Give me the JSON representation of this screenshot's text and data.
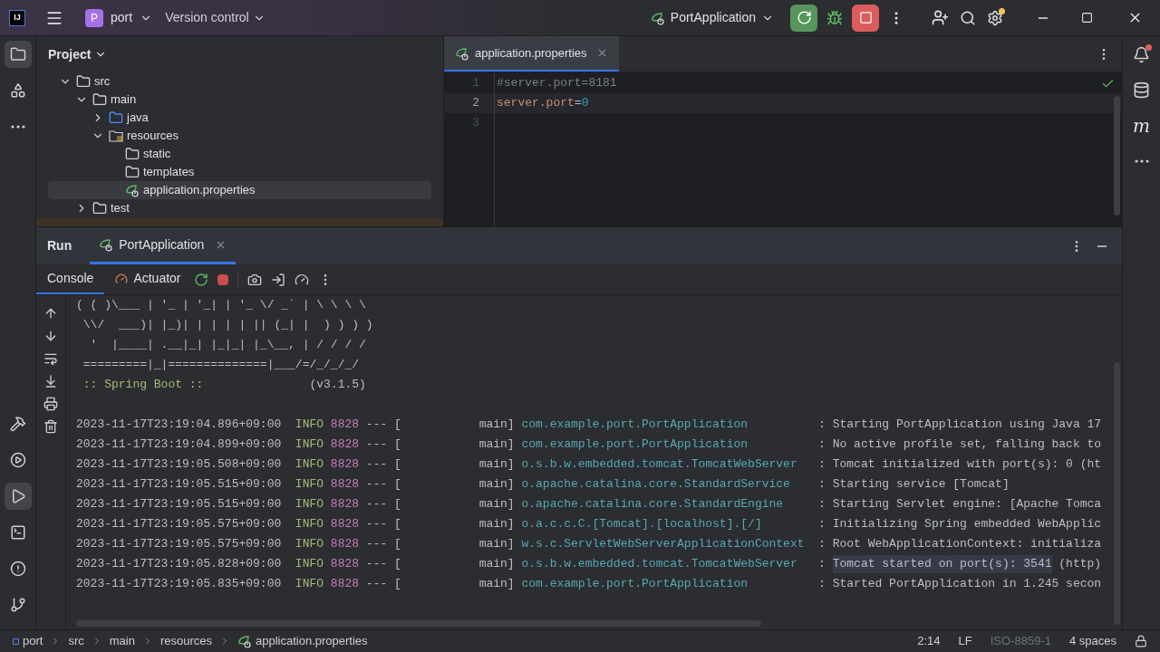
{
  "title_bar": {
    "logo": "IJ",
    "project_badge": "P",
    "project": "port",
    "vcs": "Version control",
    "run_config": "PortApplication",
    "settings_notice": true
  },
  "left_toolbar": {
    "top": [
      {
        "kind": "project",
        "selected": true
      },
      {
        "kind": "structure",
        "selected": false
      },
      {
        "kind": "more",
        "selected": false
      }
    ],
    "bottom": [
      {
        "kind": "build",
        "selected": false
      },
      {
        "kind": "services",
        "selected": false
      },
      {
        "kind": "run",
        "selected": true
      },
      {
        "kind": "terminal",
        "selected": false
      },
      {
        "kind": "problems",
        "selected": false
      },
      {
        "kind": "git",
        "selected": false
      }
    ]
  },
  "right_toolbar": [
    {
      "kind": "notifications",
      "badge": true
    },
    {
      "kind": "database",
      "badge": false
    },
    {
      "kind": "maven",
      "label": "m",
      "badge": false
    },
    {
      "kind": "more",
      "badge": false
    }
  ],
  "project_panel": {
    "title": "Project",
    "tree": [
      {
        "label": "src",
        "kind": "folder",
        "expanded": true,
        "selected": false,
        "children": [
          {
            "label": "main",
            "kind": "folder",
            "expanded": true,
            "selected": false,
            "children": [
              {
                "label": "java",
                "kind": "source-folder",
                "expanded": false,
                "selected": false
              },
              {
                "label": "resources",
                "kind": "resources-folder",
                "expanded": true,
                "selected": false,
                "children": [
                  {
                    "label": "static",
                    "kind": "folder",
                    "selected": false
                  },
                  {
                    "label": "templates",
                    "kind": "folder",
                    "selected": false
                  },
                  {
                    "label": "application.properties",
                    "kind": "spring-file",
                    "selected": true
                  }
                ]
              }
            ]
          },
          {
            "label": "test",
            "kind": "folder",
            "expanded": false,
            "selected": false
          }
        ]
      }
    ]
  },
  "editor": {
    "tab": {
      "label": "application.properties",
      "selected": true
    },
    "status_ok": true,
    "lines": [
      {
        "number": "1",
        "kind": "comment",
        "text": "#server.port=8181",
        "current": false
      },
      {
        "number": "2",
        "kind": "property",
        "key": "server.port",
        "separator": "=",
        "value": "0",
        "current": true
      },
      {
        "number": "3",
        "kind": "empty",
        "current": false
      }
    ]
  },
  "run_panel": {
    "title": "Run",
    "tabs": [
      {
        "label": "PortApplication",
        "selected": true
      }
    ],
    "subtabs": [
      {
        "label": "Console",
        "kind": "console",
        "selected": true
      },
      {
        "label": "Actuator",
        "kind": "actuator",
        "selected": false
      }
    ],
    "banner": [
      "( ( )\\___ | '_ | '_| | '_ \\/ _` | \\ \\ \\ \\",
      " \\\\/  ___)| |_)| | | | | || (_| |  ) ) ) )",
      "  '  |____| .__|_| |_|_| |_\\__, | / / / /",
      " =========|_|==============|___/=/_/_/_/"
    ],
    "spring_boot": {
      "label": " :: Spring Boot ::",
      "version": "(v3.1.5)"
    },
    "log": [
      {
        "timestamp": "2023-11-17T23:19:04.896+09:00",
        "level": "INFO",
        "pid": "8828",
        "sep": "---",
        "bracket": "[",
        "thread": "main]",
        "logger": "com.example.port.PortApplication",
        "colon": ":",
        "message": [
          {
            "text": "Starting PortApplication using Java 17",
            "selected": false
          }
        ]
      },
      {
        "timestamp": "2023-11-17T23:19:04.899+09:00",
        "level": "INFO",
        "pid": "8828",
        "sep": "---",
        "bracket": "[",
        "thread": "main]",
        "logger": "com.example.port.PortApplication",
        "colon": ":",
        "message": [
          {
            "text": "No active profile set, falling back to",
            "selected": false
          }
        ]
      },
      {
        "timestamp": "2023-11-17T23:19:05.508+09:00",
        "level": "INFO",
        "pid": "8828",
        "sep": "---",
        "bracket": "[",
        "thread": "main]",
        "logger": "o.s.b.w.embedded.tomcat.TomcatWebServer",
        "colon": ":",
        "message": [
          {
            "text": "Tomcat initialized with port(s): 0 (ht",
            "selected": false
          }
        ]
      },
      {
        "timestamp": "2023-11-17T23:19:05.515+09:00",
        "level": "INFO",
        "pid": "8828",
        "sep": "---",
        "bracket": "[",
        "thread": "main]",
        "logger": "o.apache.catalina.core.StandardService",
        "colon": ":",
        "message": [
          {
            "text": "Starting service [Tomcat]",
            "selected": false
          }
        ]
      },
      {
        "timestamp": "2023-11-17T23:19:05.515+09:00",
        "level": "INFO",
        "pid": "8828",
        "sep": "---",
        "bracket": "[",
        "thread": "main]",
        "logger": "o.apache.catalina.core.StandardEngine",
        "colon": ":",
        "message": [
          {
            "text": "Starting Servlet engine: [Apache Tomca",
            "selected": false
          }
        ]
      },
      {
        "timestamp": "2023-11-17T23:19:05.575+09:00",
        "level": "INFO",
        "pid": "8828",
        "sep": "---",
        "bracket": "[",
        "thread": "main]",
        "logger": "o.a.c.c.C.[Tomcat].[localhost].[/]",
        "colon": ":",
        "message": [
          {
            "text": "Initializing Spring embedded WebApplic",
            "selected": false
          }
        ]
      },
      {
        "timestamp": "2023-11-17T23:19:05.575+09:00",
        "level": "INFO",
        "pid": "8828",
        "sep": "---",
        "bracket": "[",
        "thread": "main]",
        "logger": "w.s.c.ServletWebServerApplicationContext",
        "colon": ":",
        "message": [
          {
            "text": "Root WebApplicationContext: initializa",
            "selected": false
          }
        ]
      },
      {
        "timestamp": "2023-11-17T23:19:05.828+09:00",
        "level": "INFO",
        "pid": "8828",
        "sep": "---",
        "bracket": "[",
        "thread": "main]",
        "logger": "o.s.b.w.embedded.tomcat.TomcatWebServer",
        "colon": ":",
        "message": [
          {
            "text": "Tomcat started on port(s): 3541",
            "selected": true
          },
          {
            "text": " (http)",
            "selected": false
          }
        ]
      },
      {
        "timestamp": "2023-11-17T23:19:05.835+09:00",
        "level": "INFO",
        "pid": "8828",
        "sep": "---",
        "bracket": "[",
        "thread": "main]",
        "logger": "com.example.port.PortApplication",
        "colon": ":",
        "message": [
          {
            "text": "Started PortApplication in 1.245 secon",
            "selected": false
          }
        ]
      }
    ]
  },
  "status_bar": {
    "breadcrumbs": [
      {
        "label": "port",
        "kind": "module"
      },
      {
        "label": "src",
        "kind": "folder"
      },
      {
        "label": "main",
        "kind": "folder"
      },
      {
        "label": "resources",
        "kind": "folder"
      },
      {
        "label": "application.properties",
        "kind": "spring-file"
      }
    ],
    "position": "2:14",
    "line_separator": "LF",
    "encoding": "ISO-8859-1",
    "indent": "4 spaces"
  }
}
